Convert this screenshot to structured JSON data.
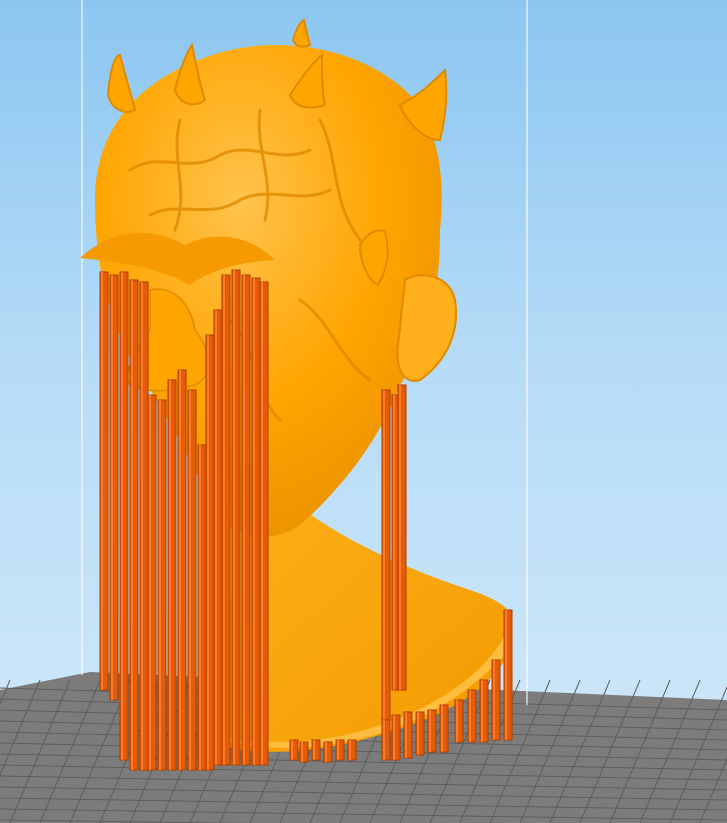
{
  "viewport": {
    "title": "",
    "colors": {
      "sky_top": "#8cc6f1",
      "sky_bottom": "#d2e9f9",
      "bed": "#7c7c7c",
      "bed_grid": "#5e5e5e",
      "model": "#ffa500",
      "model_shadow": "#e08a00",
      "model_highlight": "#ffc24a",
      "support": "#e45c06",
      "support_edge": "#a83e00",
      "build_volume_line": "#ffffff"
    },
    "model": {
      "label": "",
      "icon": "bust-model"
    },
    "supports": {
      "label": ""
    }
  }
}
